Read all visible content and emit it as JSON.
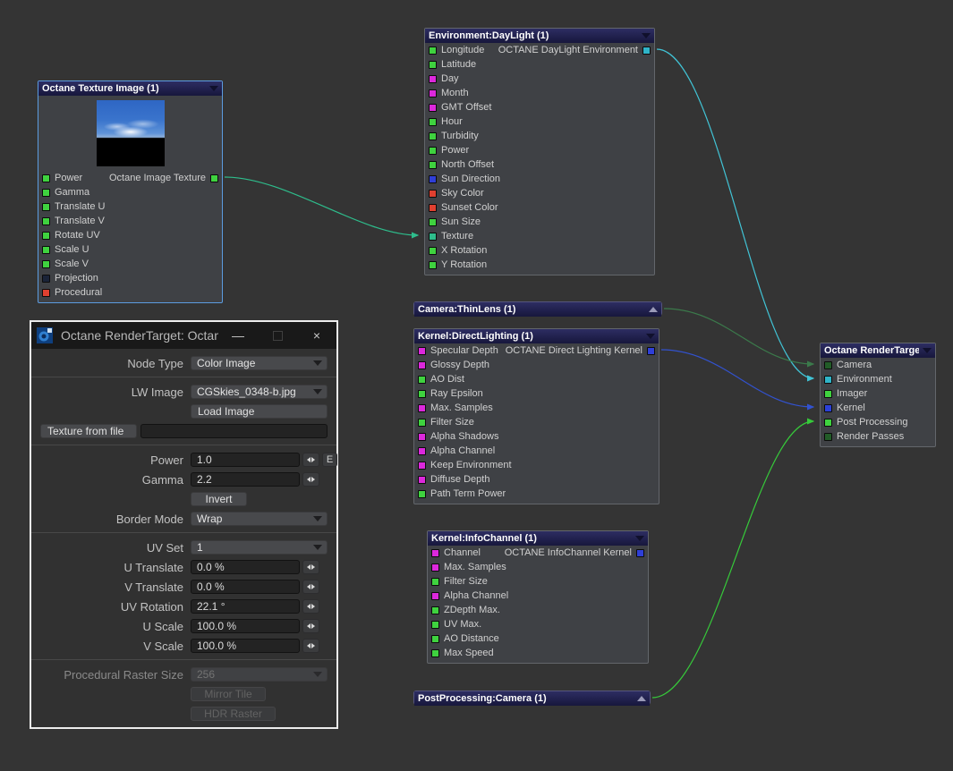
{
  "canvas": {
    "background": "#343434",
    "node_title_color": "#1d1d44",
    "selected_border": "#5c9ce0"
  },
  "nodes": [
    {
      "id": "texture-image",
      "title": "Octane Texture Image (1)",
      "collapsed": false,
      "selected": true,
      "preview": true,
      "output": {
        "label": "Octane Image Texture",
        "color": "#3fd23f"
      },
      "inputs": [
        {
          "label": "Power",
          "color": "#3fd23f"
        },
        {
          "label": "Gamma",
          "color": "#3fd23f"
        },
        {
          "label": "Translate U",
          "color": "#3fd23f"
        },
        {
          "label": "Translate V",
          "color": "#3fd23f"
        },
        {
          "label": "Rotate UV",
          "color": "#3fd23f"
        },
        {
          "label": "Scale U",
          "color": "#3fd23f"
        },
        {
          "label": "Scale V",
          "color": "#3fd23f"
        },
        {
          "label": "Projection",
          "color": "#1a2338"
        },
        {
          "label": "Procedural",
          "color": "#e04030"
        }
      ]
    },
    {
      "id": "daylight",
      "title": "Environment:DayLight (1)",
      "collapsed": false,
      "selected": false,
      "preview": false,
      "output": {
        "label": "OCTANE DayLight Environment",
        "color": "#2fb4c8"
      },
      "inputs": [
        {
          "label": "Longitude",
          "color": "#3fd23f"
        },
        {
          "label": "Latitude",
          "color": "#3fd23f"
        },
        {
          "label": "Day",
          "color": "#dc28dc"
        },
        {
          "label": "Month",
          "color": "#dc28dc"
        },
        {
          "label": "GMT Offset",
          "color": "#dc28dc"
        },
        {
          "label": "Hour",
          "color": "#3fd23f"
        },
        {
          "label": "Turbidity",
          "color": "#3fd23f"
        },
        {
          "label": "Power",
          "color": "#3fd23f"
        },
        {
          "label": "North Offset",
          "color": "#3fd23f"
        },
        {
          "label": "Sun Direction",
          "color": "#2f3fd7"
        },
        {
          "label": "Sky Color",
          "color": "#e04030"
        },
        {
          "label": "Sunset Color",
          "color": "#e04030"
        },
        {
          "label": "Sun Size",
          "color": "#3fd23f"
        },
        {
          "label": "Texture",
          "color": "#2ebd8c"
        },
        {
          "label": "X Rotation",
          "color": "#3fd23f"
        },
        {
          "label": "Y Rotation",
          "color": "#3fd23f"
        }
      ]
    },
    {
      "id": "thinlens",
      "title": "Camera:ThinLens (1)",
      "collapsed": true,
      "selected": false,
      "preview": false,
      "inputs": []
    },
    {
      "id": "directlighting",
      "title": "Kernel:DirectLighting (1)",
      "collapsed": false,
      "selected": false,
      "preview": false,
      "output": {
        "label": "OCTANE Direct Lighting Kernel",
        "color": "#2f3fd7"
      },
      "inputs": [
        {
          "label": "Specular Depth",
          "color": "#dc28dc"
        },
        {
          "label": "Glossy Depth",
          "color": "#dc28dc"
        },
        {
          "label": "AO Dist",
          "color": "#3fd23f"
        },
        {
          "label": "Ray Epsilon",
          "color": "#3fd23f"
        },
        {
          "label": "Max. Samples",
          "color": "#dc28dc"
        },
        {
          "label": "Filter Size",
          "color": "#3fd23f"
        },
        {
          "label": "Alpha Shadows",
          "color": "#dc28dc"
        },
        {
          "label": "Alpha Channel",
          "color": "#dc28dc"
        },
        {
          "label": "Keep Environment",
          "color": "#dc28dc"
        },
        {
          "label": "Diffuse Depth",
          "color": "#dc28dc"
        },
        {
          "label": "Path Term Power",
          "color": "#3fd23f"
        }
      ]
    },
    {
      "id": "infochannel",
      "title": "Kernel:InfoChannel (1)",
      "collapsed": false,
      "selected": false,
      "preview": false,
      "output": {
        "label": "OCTANE InfoChannel Kernel",
        "color": "#2f3fd7"
      },
      "inputs": [
        {
          "label": "Channel",
          "color": "#dc28dc"
        },
        {
          "label": "Max. Samples",
          "color": "#dc28dc"
        },
        {
          "label": "Filter Size",
          "color": "#3fd23f"
        },
        {
          "label": "Alpha Channel",
          "color": "#dc28dc"
        },
        {
          "label": "ZDepth Max.",
          "color": "#3fd23f"
        },
        {
          "label": "UV Max.",
          "color": "#3fd23f"
        },
        {
          "label": "AO Distance",
          "color": "#3fd23f"
        },
        {
          "label": "Max Speed",
          "color": "#3fd23f"
        }
      ]
    },
    {
      "id": "postprocessing",
      "title": "PostProcessing:Camera (1)",
      "collapsed": true,
      "selected": false,
      "preview": false,
      "inputs": []
    },
    {
      "id": "rendertarget",
      "title": "Octane RenderTarget",
      "collapsed": false,
      "selected": false,
      "preview": false,
      "inputs": [
        {
          "label": "Camera",
          "color": "#225c28"
        },
        {
          "label": "Environment",
          "color": "#2fb4c8"
        },
        {
          "label": "Imager",
          "color": "#3fd23f"
        },
        {
          "label": "Kernel",
          "color": "#2b41d8"
        },
        {
          "label": "Post Processing",
          "color": "#3fd23f"
        },
        {
          "label": "Render Passes",
          "color": "#225c28"
        }
      ]
    }
  ],
  "connections": [
    {
      "from": "texture-image",
      "to": "daylight",
      "port": "Texture",
      "color": "#2ebd8c"
    },
    {
      "from": "daylight",
      "to": "rendertarget",
      "port": "Environment",
      "color": "#41c3d5"
    },
    {
      "from": "thinlens",
      "to": "rendertarget",
      "port": "Camera",
      "color": "#3b7a4b"
    },
    {
      "from": "directlighting",
      "to": "rendertarget",
      "port": "Kernel",
      "color": "#3252cf"
    },
    {
      "from": "postprocessing",
      "to": "rendertarget",
      "port": "Post Processing",
      "color": "#36c93a"
    }
  ],
  "dialog": {
    "title": "Octane RenderTarget: Octane T...",
    "minimize_glyph": "—",
    "close_glyph": "×",
    "node_type": {
      "label": "Node Type",
      "value": "Color Image"
    },
    "lw_image": {
      "label": "LW Image",
      "value": "CGSkies_0348-b.jpg"
    },
    "load_image_label": "Load Image",
    "texture_from_file_label": "Texture from file",
    "texture_file_value": "",
    "power": {
      "label": "Power",
      "value": "1.0",
      "envelope_label": "E"
    },
    "gamma": {
      "label": "Gamma",
      "value": "2.2"
    },
    "invert_label": "Invert",
    "border_mode": {
      "label": "Border Mode",
      "value": "Wrap"
    },
    "uv_set": {
      "label": "UV Set",
      "value": "1"
    },
    "u_translate": {
      "label": "U Translate",
      "value": "0.0 %"
    },
    "v_translate": {
      "label": "V Translate",
      "value": "0.0 %"
    },
    "uv_rotation": {
      "label": "UV Rotation",
      "value": "22.1 °"
    },
    "u_scale": {
      "label": "U Scale",
      "value": "100.0 %"
    },
    "v_scale": {
      "label": "V Scale",
      "value": "100.0 %"
    },
    "raster_size": {
      "label": "Procedural Raster Size",
      "value": "256"
    },
    "mirror_tile_label": "Mirror Tile",
    "hdr_raster_label": "HDR Raster"
  }
}
